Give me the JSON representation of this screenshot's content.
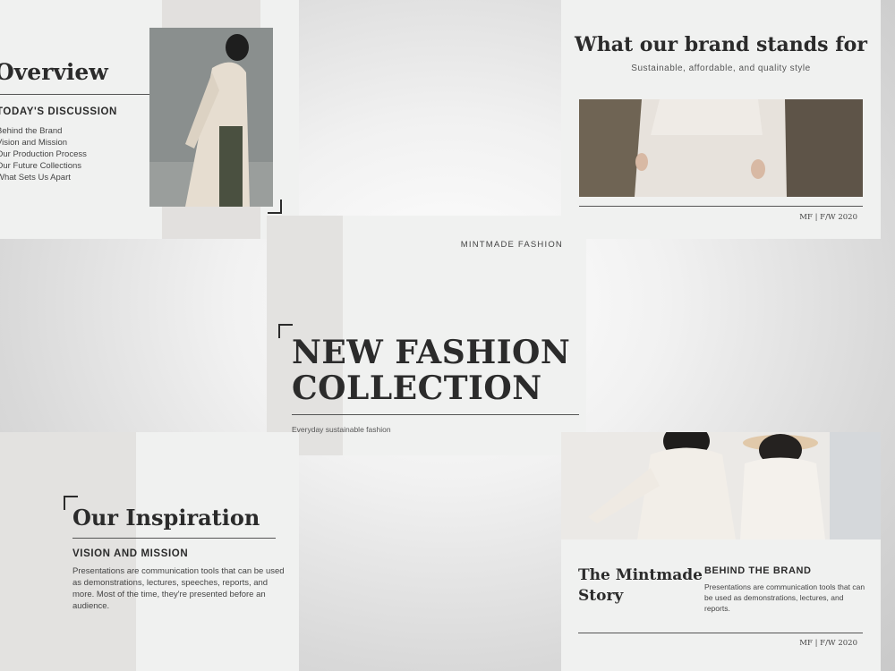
{
  "slides": {
    "overview": {
      "title": "Overview",
      "subheading": "TODAY'S DISCUSSION",
      "items": [
        "Behind the Brand",
        "Vision and Mission",
        "Our Production Process",
        "Our Future Collections",
        "What Sets Us Apart"
      ]
    },
    "brand_stands": {
      "title": "What our brand stands for",
      "subtitle": "Sustainable, affordable, and quality style",
      "footer": "MF | F/W 2020"
    },
    "cover": {
      "brand_name": "MINTMADE FASHION",
      "title_line1": "NEW FASHION",
      "title_line2": "COLLECTION",
      "tagline": "Everyday sustainable fashion"
    },
    "inspiration": {
      "title": "Our Inspiration",
      "subheading": "VISION AND MISSION",
      "body": "Presentations are communication tools that can be used as demonstrations, lectures, speeches, reports, and more. Most of the time, they're presented before an audience."
    },
    "story": {
      "title_line1": "The Mintmade",
      "title_line2": "Story",
      "subheading": "BEHIND THE BRAND",
      "body": "Presentations are communication tools that can be used as demonstrations, lectures, and reports.",
      "footer": "MF | F/W 2020"
    }
  },
  "colors": {
    "background": "#d9d9d9",
    "slide": "#f0f1f0",
    "band": "#e3e2e0",
    "text": "#2b2b2b"
  }
}
